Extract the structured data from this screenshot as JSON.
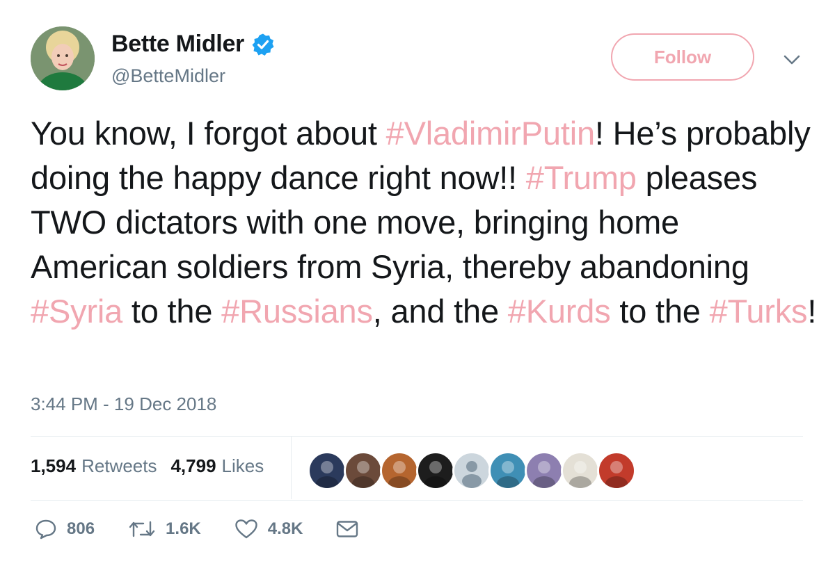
{
  "user": {
    "display_name": "Bette Midler",
    "handle": "@BetteMidler",
    "verified": true
  },
  "follow_button": {
    "label": "Follow"
  },
  "tweet": {
    "segments": [
      {
        "text": "You know, I forgot about ",
        "hashtag": false
      },
      {
        "text": "#VladimirPutin",
        "hashtag": true
      },
      {
        "text": "! He’s probably doing the happy dance right now!! ",
        "hashtag": false
      },
      {
        "text": "#Trump",
        "hashtag": true
      },
      {
        "text": " pleases TWO dictators with one move, bringing home American soldiers from Syria, thereby abandoning ",
        "hashtag": false
      },
      {
        "text": "#Syria",
        "hashtag": true
      },
      {
        "text": " to the ",
        "hashtag": false
      },
      {
        "text": "#Russians",
        "hashtag": true
      },
      {
        "text": ", and the ",
        "hashtag": false
      },
      {
        "text": "#Kurds",
        "hashtag": true
      },
      {
        "text": " to the ",
        "hashtag": false
      },
      {
        "text": "#Turks",
        "hashtag": true
      },
      {
        "text": "!",
        "hashtag": false
      }
    ],
    "timestamp": "3:44 PM - 19 Dec 2018"
  },
  "stats": {
    "retweets_count": "1,594",
    "retweets_label": "Retweets",
    "likes_count": "4,799",
    "likes_label": "Likes"
  },
  "likers": [
    {
      "icon": "aurora-avatar",
      "color": "#2b3a5c"
    },
    {
      "icon": "woman-avatar",
      "color": "#6b4a3a"
    },
    {
      "icon": "person-avatar",
      "color": "#b5652f"
    },
    {
      "icon": "dog-avatar",
      "color": "#1d1d1d"
    },
    {
      "icon": "default-avatar",
      "color": "#ccd6dd"
    },
    {
      "icon": "beach-avatar",
      "color": "#3f8fb5"
    },
    {
      "icon": "owl-avatar",
      "color": "#8d7fb0"
    },
    {
      "icon": "kid-avatar",
      "color": "#e4e0d6"
    },
    {
      "icon": "man-avatar",
      "color": "#c23b2b"
    }
  ],
  "actions": {
    "reply_count": "806",
    "retweet_count": "1.6K",
    "like_count": "4.8K"
  },
  "colors": {
    "accent": "#f1a6b0",
    "verified": "#1da1f2",
    "secondary_text": "#657786",
    "primary_text": "#14171a",
    "divider": "#e6ecf0"
  }
}
